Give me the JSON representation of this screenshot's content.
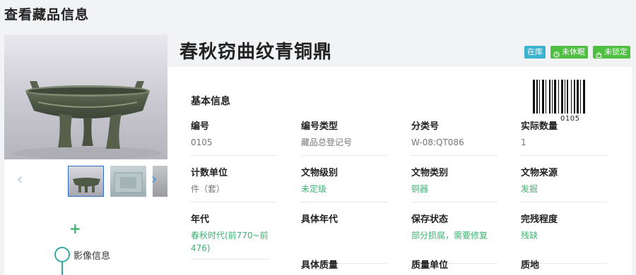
{
  "page": {
    "title": "查看藏品信息"
  },
  "gallery": {
    "prev_icon": "chevron-left-icon",
    "next_icon": "chevron-right-icon",
    "add_icon": "plus-icon",
    "timeline_label": "影像信息"
  },
  "object": {
    "name": "春秋窃曲纹青铜鼎",
    "badges": [
      {
        "label": "在库",
        "color": "#3bb3cf",
        "icon": ""
      },
      {
        "label": "未休眠",
        "color": "#4fbf40",
        "icon": "clock-icon"
      },
      {
        "label": "未锁定",
        "color": "#4fbf40",
        "icon": "lock-icon"
      }
    ]
  },
  "basic_info": {
    "section_title": "基本信息",
    "barcode_number": "0105",
    "fields": [
      {
        "label": "编号",
        "value": "0105"
      },
      {
        "label": "编号类型",
        "value": "藏品总登记号"
      },
      {
        "label": "分类号",
        "value": "W-08:QT086"
      },
      {
        "label": "实际数量",
        "value": "1"
      },
      {
        "label": "计数单位",
        "value": "件（套）"
      },
      {
        "label": "文物级别",
        "value": "未定级"
      },
      {
        "label": "文物类别",
        "value": "铜器"
      },
      {
        "label": "文物来源",
        "value": "发掘"
      },
      {
        "label": "年代",
        "value": "春秋时代(前770~前476)"
      },
      {
        "label": "具体年代",
        "value": ""
      },
      {
        "label": "保存状态",
        "value": "部分损腐，需要修复"
      },
      {
        "label": "完残程度",
        "value": "残缺"
      },
      {
        "label": "具体质量",
        "value": ""
      },
      {
        "label": "质量单位",
        "value": ""
      },
      {
        "label": "质地",
        "value": ""
      }
    ]
  }
}
